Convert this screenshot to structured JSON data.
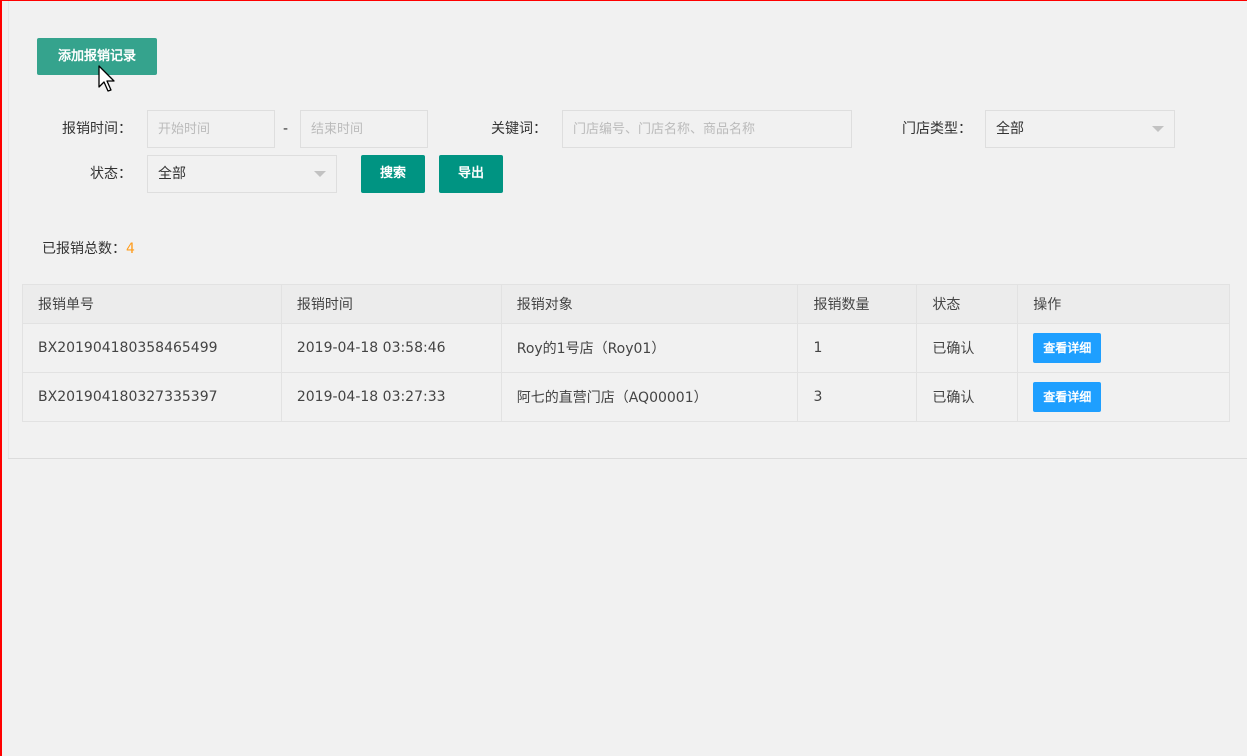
{
  "toolbar": {
    "add_label": "添加报销记录"
  },
  "filters": {
    "time_label": "报销时间：",
    "start_placeholder": "开始时间",
    "dash": "-",
    "end_placeholder": "结束时间",
    "keyword_label": "关键词：",
    "keyword_placeholder": "门店编号、门店名称、商品名称",
    "store_type_label": "门店类型：",
    "store_type_value": "全部",
    "status_label": "状态：",
    "status_value": "全部",
    "search_label": "搜索",
    "export_label": "导出"
  },
  "summary": {
    "total_label": "已报销总数：",
    "total_value": "4"
  },
  "table": {
    "headers": [
      "报销单号",
      "报销时间",
      "报销对象",
      "报销数量",
      "状态",
      "操作"
    ],
    "rows": [
      {
        "id": "BX201904180358465499",
        "time": "2019-04-18 03:58:46",
        "target": "Roy的1号店（Roy01）",
        "qty": "1",
        "status": "已确认",
        "action": "查看详细"
      },
      {
        "id": "BX201904180327335397",
        "time": "2019-04-18 03:27:33",
        "target": "阿七的直营门店（AQ00001）",
        "qty": "3",
        "status": "已确认",
        "action": "查看详细"
      }
    ]
  },
  "colors": {
    "add_button": "#35a38d",
    "primary_green": "#009482",
    "detail_button": "#1e9fff",
    "total_number": "#ff9d1d"
  },
  "icons": {
    "cursor": "mouse-pointer-icon",
    "dropdown": "caret-down-icon"
  }
}
